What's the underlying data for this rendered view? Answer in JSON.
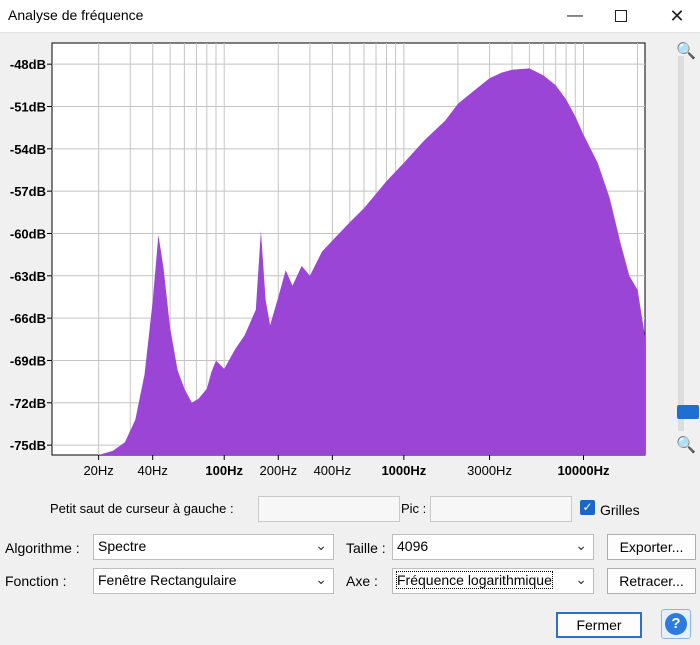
{
  "window": {
    "title": "Analyse de fréquence"
  },
  "chart_data": {
    "type": "area",
    "title": "",
    "xlabel": "",
    "ylabel": "",
    "x_scale": "log",
    "grid": true,
    "legend": "none",
    "color": "#9b45d6",
    "xlim": [
      11,
      22000
    ],
    "ylim": [
      -75.7,
      -46.5
    ],
    "y_ticks": [
      -48,
      -51,
      -54,
      -57,
      -60,
      -63,
      -66,
      -69,
      -72,
      -75
    ],
    "y_tick_labels": [
      "-48dB",
      "-51dB",
      "-54dB",
      "-57dB",
      "-60dB",
      "-63dB",
      "-66dB",
      "-69dB",
      "-72dB",
      "-75dB"
    ],
    "x_ticks": [
      20,
      40,
      100,
      200,
      400,
      1000,
      3000,
      10000
    ],
    "x_tick_labels": [
      "20Hz",
      "40Hz",
      "100Hz",
      "200Hz",
      "400Hz",
      "1000Hz",
      "3000Hz",
      "10000Hz"
    ],
    "x_ticks_bold": [
      100,
      1000,
      10000
    ],
    "x": [
      11,
      20,
      24,
      28,
      32,
      36,
      40,
      43,
      46,
      50,
      55,
      60,
      66,
      72,
      80,
      85,
      90,
      100,
      115,
      130,
      150,
      160,
      170,
      180,
      200,
      220,
      240,
      270,
      300,
      350,
      400,
      500,
      600,
      800,
      1000,
      1300,
      1700,
      2000,
      2500,
      3000,
      3500,
      4000,
      5000,
      6000,
      7000,
      8000,
      9000,
      10000,
      12000,
      14000,
      16000,
      18000,
      20000,
      22000
    ],
    "y": [
      -75.7,
      -75.7,
      -75.4,
      -74.8,
      -73.2,
      -70.0,
      -64.8,
      -60.1,
      -62.5,
      -66.7,
      -69.7,
      -71.0,
      -72.0,
      -71.7,
      -71.0,
      -69.8,
      -69.0,
      -69.6,
      -68.2,
      -67.2,
      -65.4,
      -59.8,
      -64.7,
      -66.5,
      -64.5,
      -62.6,
      -63.7,
      -62.3,
      -63.0,
      -61.3,
      -60.5,
      -59.2,
      -58.2,
      -56.3,
      -55.0,
      -53.4,
      -52.0,
      -50.8,
      -49.8,
      -49.0,
      -48.6,
      -48.4,
      -48.3,
      -48.8,
      -49.5,
      -50.5,
      -51.7,
      -53.0,
      -55.0,
      -57.5,
      -60.6,
      -63.0,
      -64.0,
      -67.3
    ]
  },
  "form": {
    "cursor_label": "Petit saut de curseur à gauche :",
    "cursor_value": "",
    "pic_label": "Pic :",
    "pic_value": "",
    "grids_label": "Grilles",
    "grids_checked": true,
    "algorithm_label": "Algorithme :",
    "algorithm_value": "Spectre",
    "size_label": "Taille :",
    "size_value": "4096",
    "function_label": "Fonction :",
    "function_value": "Fenêtre Rectangulaire",
    "axis_label": "Axe :",
    "axis_value": "Fréquence logarithmique"
  },
  "buttons": {
    "export": "Exporter...",
    "replot": "Retracer...",
    "close": "Fermer",
    "help": "?"
  },
  "icons": {
    "minimize": "minimize-icon",
    "maximize": "maximize-icon",
    "close": "close-icon",
    "zoom_in": "zoom-in-icon",
    "zoom_out": "zoom-out-icon",
    "chevron": "chevron-down-icon",
    "check": "check-icon"
  }
}
